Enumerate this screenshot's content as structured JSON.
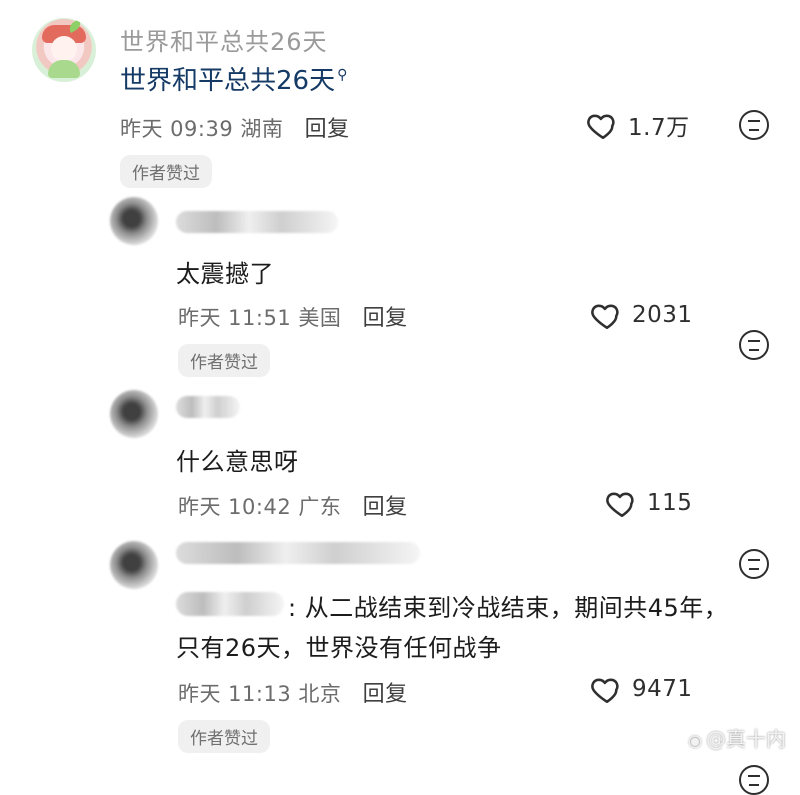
{
  "post": {
    "user_name": "世界和平总共26天",
    "content": "世界和平总共26天",
    "search_icon": "magnifier-icon",
    "time": "昨天 09:39 湖南",
    "reply_label": "回复",
    "likes": "1.7万",
    "badge": "作者赞过"
  },
  "comments": [
    {
      "content": "太震撼了",
      "time": "昨天 11:51 美国",
      "reply_label": "回复",
      "likes": "2031",
      "badge": "作者赞过"
    },
    {
      "content": "什么意思呀",
      "time": "昨天 10:42 广东",
      "reply_label": "回复",
      "likes": "115"
    },
    {
      "content_line1": ": 从二战结束到冷战结束，期间共45年，",
      "content_line2": "只有26天，世界没有任何战争",
      "time": "昨天 11:13 北京",
      "reply_label": "回复",
      "likes": "9471",
      "badge": "作者赞过"
    }
  ],
  "watermark": "@真十内",
  "icons": {
    "heart": "heart-icon",
    "emoji": "neutral-face-icon",
    "weibo": "weibo-icon"
  }
}
